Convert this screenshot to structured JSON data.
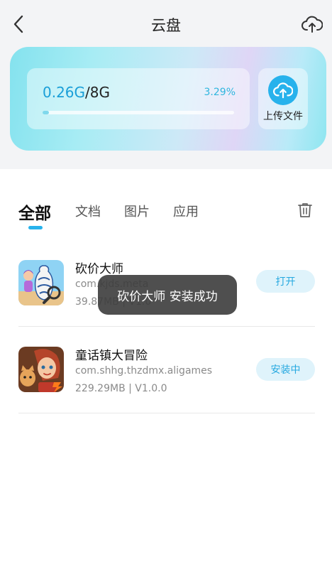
{
  "header": {
    "title": "云盘",
    "back_icon": "chevron-left-icon",
    "cloud_icon": "cloud-upload-icon"
  },
  "storage": {
    "used": "0.26G",
    "total": "/8G",
    "percent": "3.29%",
    "progress": 0.0329,
    "upload_label": "上传文件",
    "upload_icon": "cloud-upload-icon"
  },
  "tabs": [
    {
      "label": "全部",
      "active": true
    },
    {
      "label": "文档",
      "active": false
    },
    {
      "label": "图片",
      "active": false
    },
    {
      "label": "应用",
      "active": false
    }
  ],
  "trash_icon": "trash-icon",
  "apps": [
    {
      "name": "砍价大师",
      "package": "com.kjds.meta",
      "meta": "39.87MB | V1.0",
      "action": "打开"
    },
    {
      "name": "童话镇大冒险",
      "package": "com.shhg.thzdmx.aligames",
      "meta": "229.29MB | V1.0.0",
      "action": "安装中"
    }
  ],
  "toast": "砍价大师 安装成功",
  "colors": {
    "accent": "#27b2ec",
    "button_bg": "#dff3fb"
  }
}
